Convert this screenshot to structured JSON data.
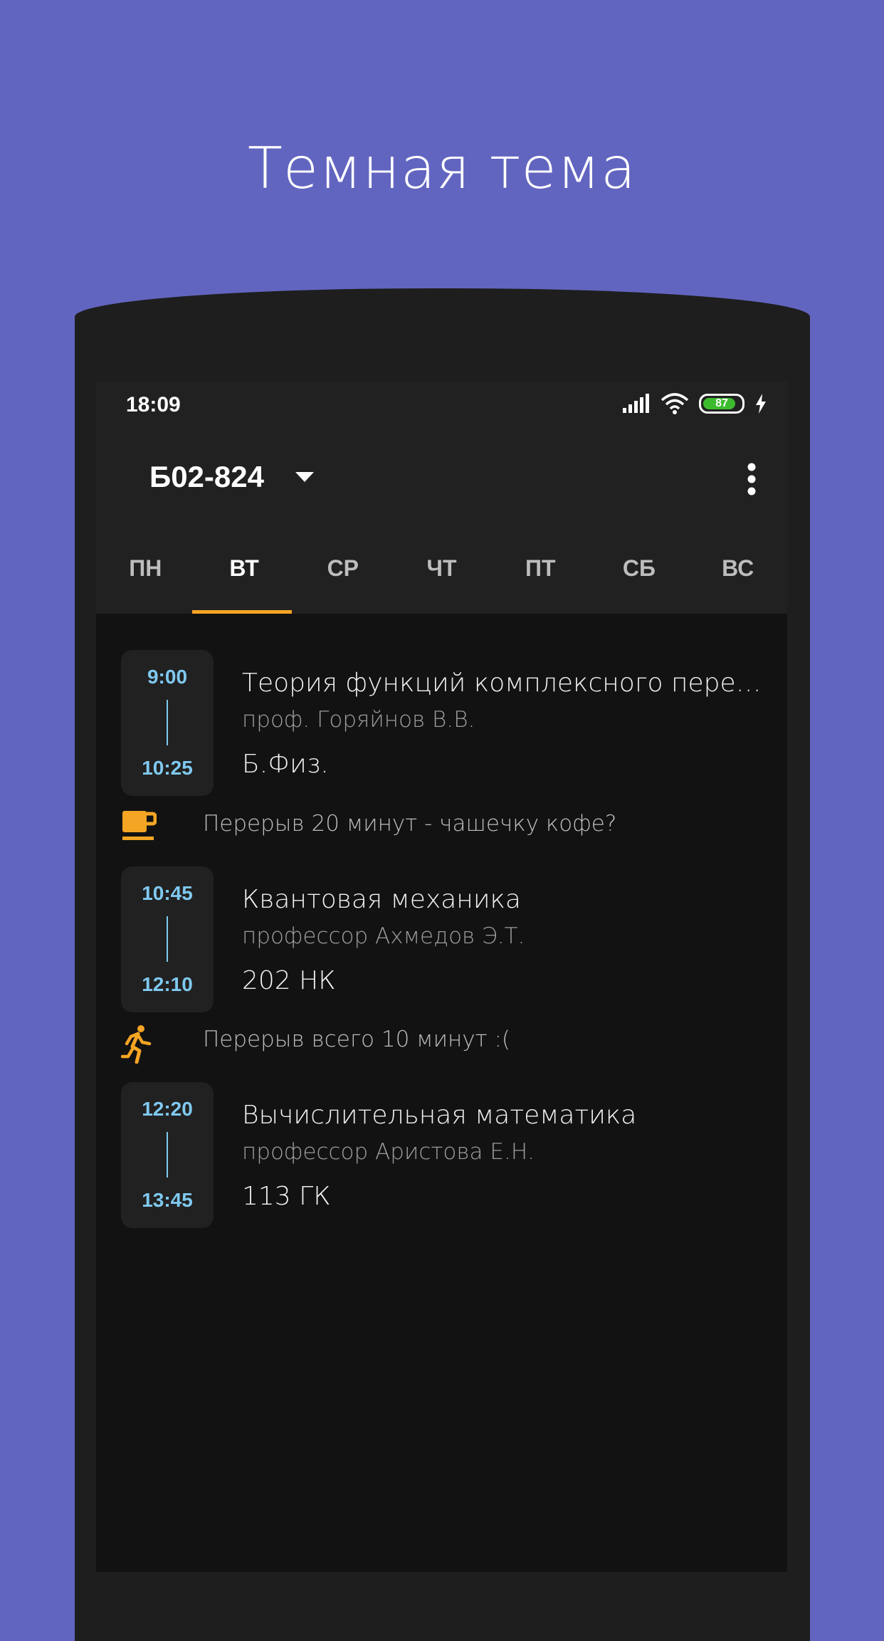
{
  "headline": "Темная тема",
  "status_bar": {
    "time": "18:09",
    "battery_level": "87",
    "battery_fraction": 0.87,
    "icons": [
      "signal-icon",
      "wifi-icon",
      "battery-icon",
      "charging-icon"
    ]
  },
  "appbar": {
    "group": "Б02-824",
    "dropdown_icon": "dropdown-arrow-icon",
    "menu_icon": "more-vert-icon"
  },
  "tabs": [
    {
      "label": "ПН"
    },
    {
      "label": "ВТ",
      "active": true
    },
    {
      "label": "СР"
    },
    {
      "label": "ЧТ"
    },
    {
      "label": "ПТ"
    },
    {
      "label": "СБ"
    },
    {
      "label": "ВС"
    }
  ],
  "lessons": [
    {
      "start": "9:00",
      "end": "10:25",
      "title": "Теория функций комплексного перем...",
      "teacher": "проф. Горяйнов В.В.",
      "room": "Б.Физ."
    },
    {
      "start": "10:45",
      "end": "12:10",
      "title": "Квантовая механика",
      "teacher": "профессор Ахмедов Э.Т.",
      "room": "202 НК"
    },
    {
      "start": "12:20",
      "end": "13:45",
      "title": "Вычислительная математика",
      "teacher": "профессор Аристова Е.Н.",
      "room": "113 ГК"
    }
  ],
  "breaks": [
    {
      "icon": "coffee-cup-icon",
      "text": "Перерыв 20 минут - чашечку кофе?"
    },
    {
      "icon": "running-person-icon",
      "text": "Перерыв всего 10 минут :("
    }
  ],
  "colors": {
    "background": "#6265bf",
    "accent": "#f5a524",
    "time_text": "#7fc9f0",
    "appbar": "#212121",
    "screen": "#121212",
    "battery": "#3dbb2f"
  }
}
